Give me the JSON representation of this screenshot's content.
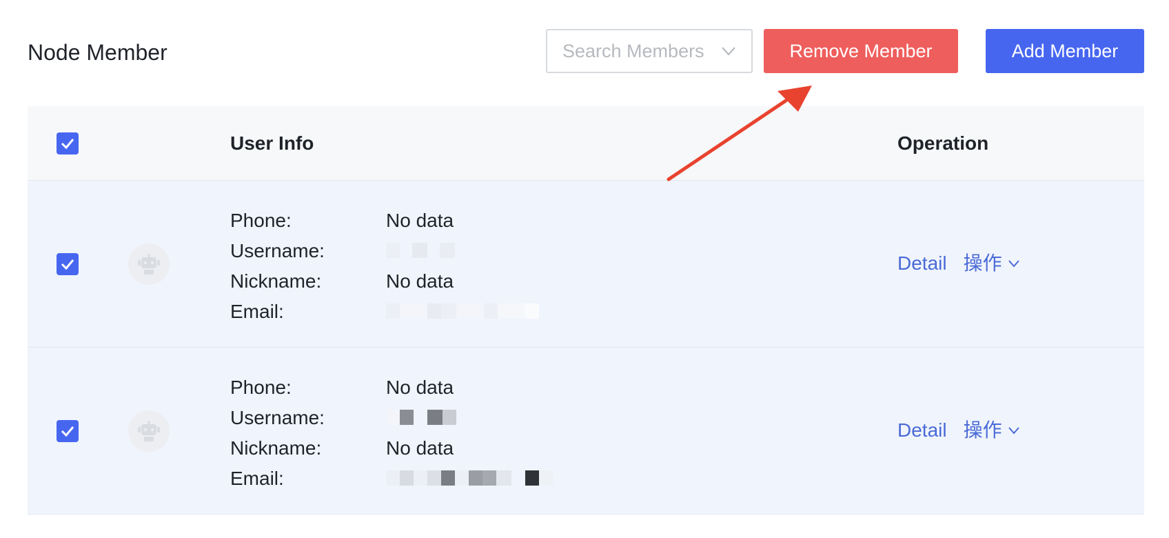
{
  "header": {
    "title": "Node Member",
    "search_placeholder": "Search Members",
    "remove_label": "Remove Member",
    "add_label": "Add Member"
  },
  "table": {
    "columns": [
      "User Info",
      "Operation"
    ],
    "field_labels": {
      "phone": "Phone:",
      "username": "Username:",
      "nickname": "Nickname:",
      "email": "Email:"
    },
    "rows": [
      {
        "phone": "No data",
        "nickname": "No data",
        "detail_label": "Detail",
        "more_label": "操作"
      },
      {
        "phone": "No data",
        "nickname": "No data",
        "detail_label": "Detail",
        "more_label": "操作"
      }
    ]
  },
  "colors": {
    "primary": "#4766f0",
    "danger": "#ee5e5c",
    "link": "#4a6bd6",
    "row_highlight": "#f0f4fc",
    "annotation_arrow": "#e8432f"
  },
  "icons": {
    "checkbox": "check-icon",
    "avatar": "robot-avatar-icon",
    "dropdown": "chevron-down-icon"
  }
}
